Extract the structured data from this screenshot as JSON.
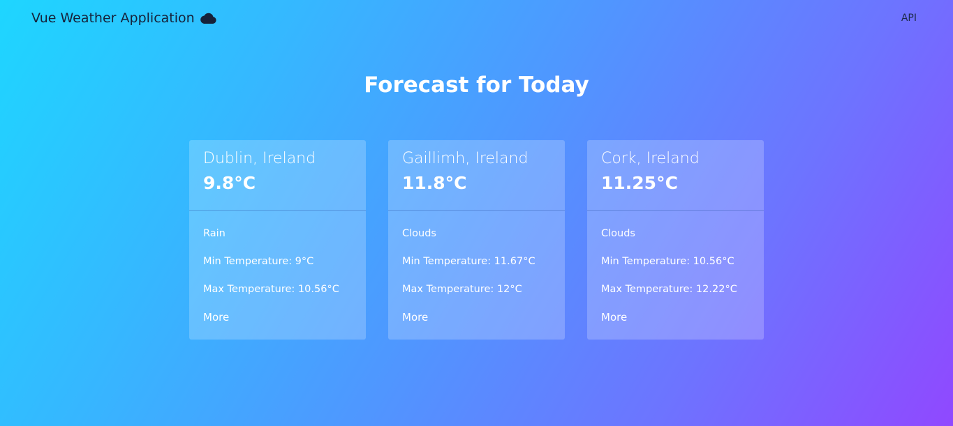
{
  "navbar": {
    "brand": "Vue Weather Application",
    "brand_icon": "cloud-icon",
    "api_link": "API"
  },
  "page": {
    "title": "Forecast for Today"
  },
  "cards": [
    {
      "city": "Dublin, Ireland",
      "temp": "9.8°C",
      "condition": "Rain",
      "min": "Min Temperature: 9°C",
      "max": "Max Temperature: 10.56°C",
      "more": "More"
    },
    {
      "city": "Gaillimh, Ireland",
      "temp": "11.8°C",
      "condition": "Clouds",
      "min": "Min Temperature: 11.67°C",
      "max": "Max Temperature: 12°C",
      "more": "More"
    },
    {
      "city": "Cork, Ireland",
      "temp": "11.25°C",
      "condition": "Clouds",
      "min": "Min Temperature: 10.56°C",
      "max": "Max Temperature: 12.22°C",
      "more": "More"
    }
  ]
}
